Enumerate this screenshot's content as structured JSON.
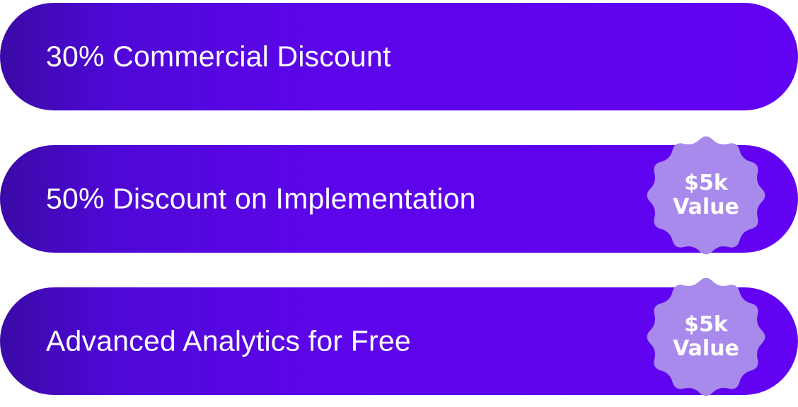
{
  "offers": [
    {
      "label": "30% Commercial Discount"
    },
    {
      "label": "50% Discount on Implementation",
      "badge": {
        "line1": "$5k",
        "line2": "Value"
      }
    },
    {
      "label": "Advanced Analytics for Free",
      "badge": {
        "line1": "$5k",
        "line2": "Value"
      }
    }
  ],
  "colors": {
    "pill_start": "#3a0aa6",
    "pill_end": "#6202f2",
    "badge_fill": "#a88aec",
    "text": "#ffffff"
  },
  "icons": {
    "badge_shape": "starburst-seal-icon"
  }
}
